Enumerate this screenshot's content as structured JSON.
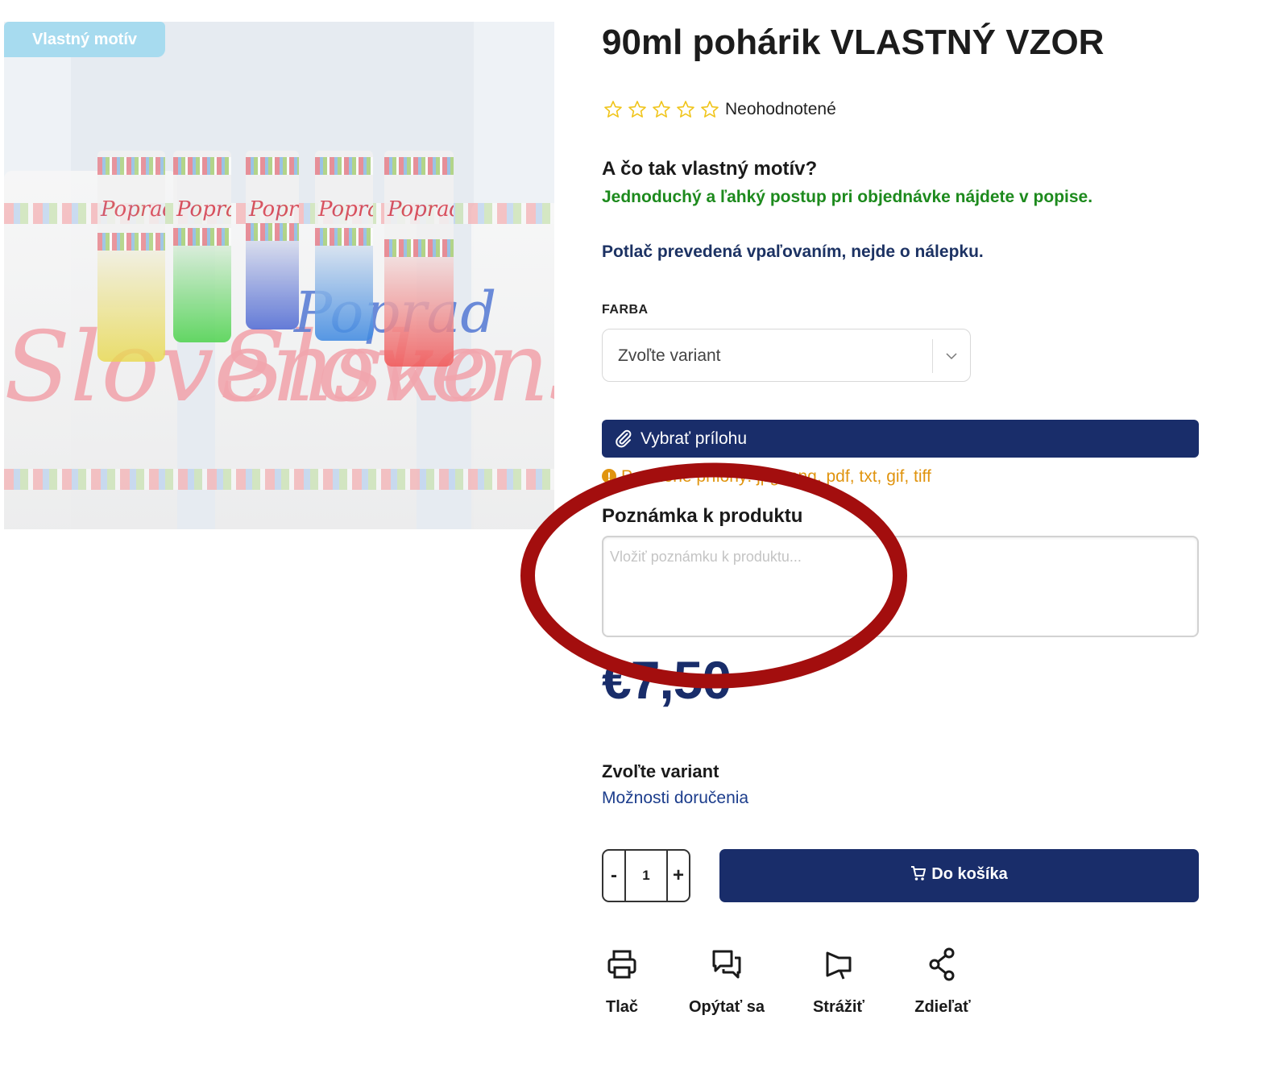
{
  "image": {
    "badge": "Vlastný motív",
    "print_text_main": "Slovensko",
    "print_text_town": "Poprad",
    "glass_colors": [
      "#e8d84a",
      "#4bd24b",
      "#4b66d2",
      "#3b87e0",
      "#f05a5a"
    ]
  },
  "product": {
    "title": "90ml pohárik VLASTNÝ VZOR",
    "rating_stars": 5,
    "rating_filled": 0,
    "rating_text": "Neohodnotené",
    "promo_heading": "A čo tak vlastný motív?",
    "promo_subtext": "Jednoduchý a ľahký postup pri objednávke nájdete v popise.",
    "print_note": "Potlač prevedená vpaľovaním, nejde o nálepku.",
    "price": "€7,50"
  },
  "variant": {
    "label": "FARBA",
    "selected": "Zvoľte variant"
  },
  "attachment": {
    "button_label": "Vybrať prílohu",
    "allowed_text": "Povolené prílohy: jpg, png, pdf, txt, gif, tiff"
  },
  "note": {
    "label": "Poznámka k produktu",
    "placeholder": "Vložiť poznámku k produktu..."
  },
  "purchase": {
    "choose_variant": "Zvoľte variant",
    "delivery_link": "Možnosti doručenia",
    "quantity": "1",
    "minus": "-",
    "plus": "+",
    "cart_label": "Do košíka"
  },
  "actions": [
    {
      "label": "Tlač",
      "icon": "printer-icon"
    },
    {
      "label": "Opýtať sa",
      "icon": "chat-icon"
    },
    {
      "label": "Strážiť",
      "icon": "megaphone-icon"
    },
    {
      "label": "Zdieľať",
      "icon": "share-icon"
    }
  ],
  "colors": {
    "brand": "#192d6a",
    "promo_green": "#1d8a1d",
    "warning_orange": "#e0940f",
    "annotation_red": "#a30e0e",
    "star_yellow": "#f0c419"
  }
}
